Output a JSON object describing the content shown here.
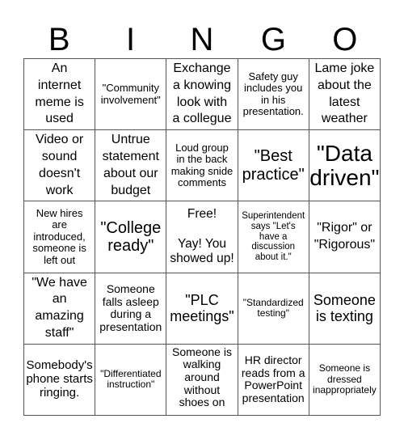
{
  "header": {
    "letters": [
      "B",
      "I",
      "N",
      "G",
      "O"
    ]
  },
  "board": {
    "cells": [
      [
        "An\ninternet\nmeme is\nused",
        "\"Community\ninvolvement\"",
        "Exchange\na knowing\nlook with\na collegue",
        "Safety guy\nincludes you\nin his\npresentation.",
        "Lame joke\nabout the\nlatest\nweather"
      ],
      [
        "Video or\nsound\ndoesn't\nwork",
        "Untrue\nstatement\nabout our\nbudget",
        "Loud group\nin the back\nmaking snide\ncomments",
        "\"Best\npractice\"",
        "\"Data\ndriven\""
      ],
      [
        "New hires\nare\nintroduced,\nsomeone is\nleft out",
        "\"College\nready\"",
        "Free!\n\nYay! You\nshowed up!",
        "Superintendent\nsays \"Let's\nhave a\ndiscussion\nabout it.\"",
        "\"Rigor\" or\n\"Rigorous\""
      ],
      [
        "\"We have\nan\namazing\nstaff\"",
        "Someone\nfalls asleep\nduring a\npresentation",
        "\"PLC\nmeetings\"",
        "\"Standardized\ntesting\"",
        "Someone\nis texting"
      ],
      [
        "Somebody's\nphone starts\nringing.",
        "\"Differentiated\ninstruction\"",
        "Someone is\nwalking\naround\nwithout\nshoes on",
        "HR director\nreads from a\nPowerPoint\npresentation",
        "Someone is\ndressed\ninappropriately"
      ]
    ]
  }
}
